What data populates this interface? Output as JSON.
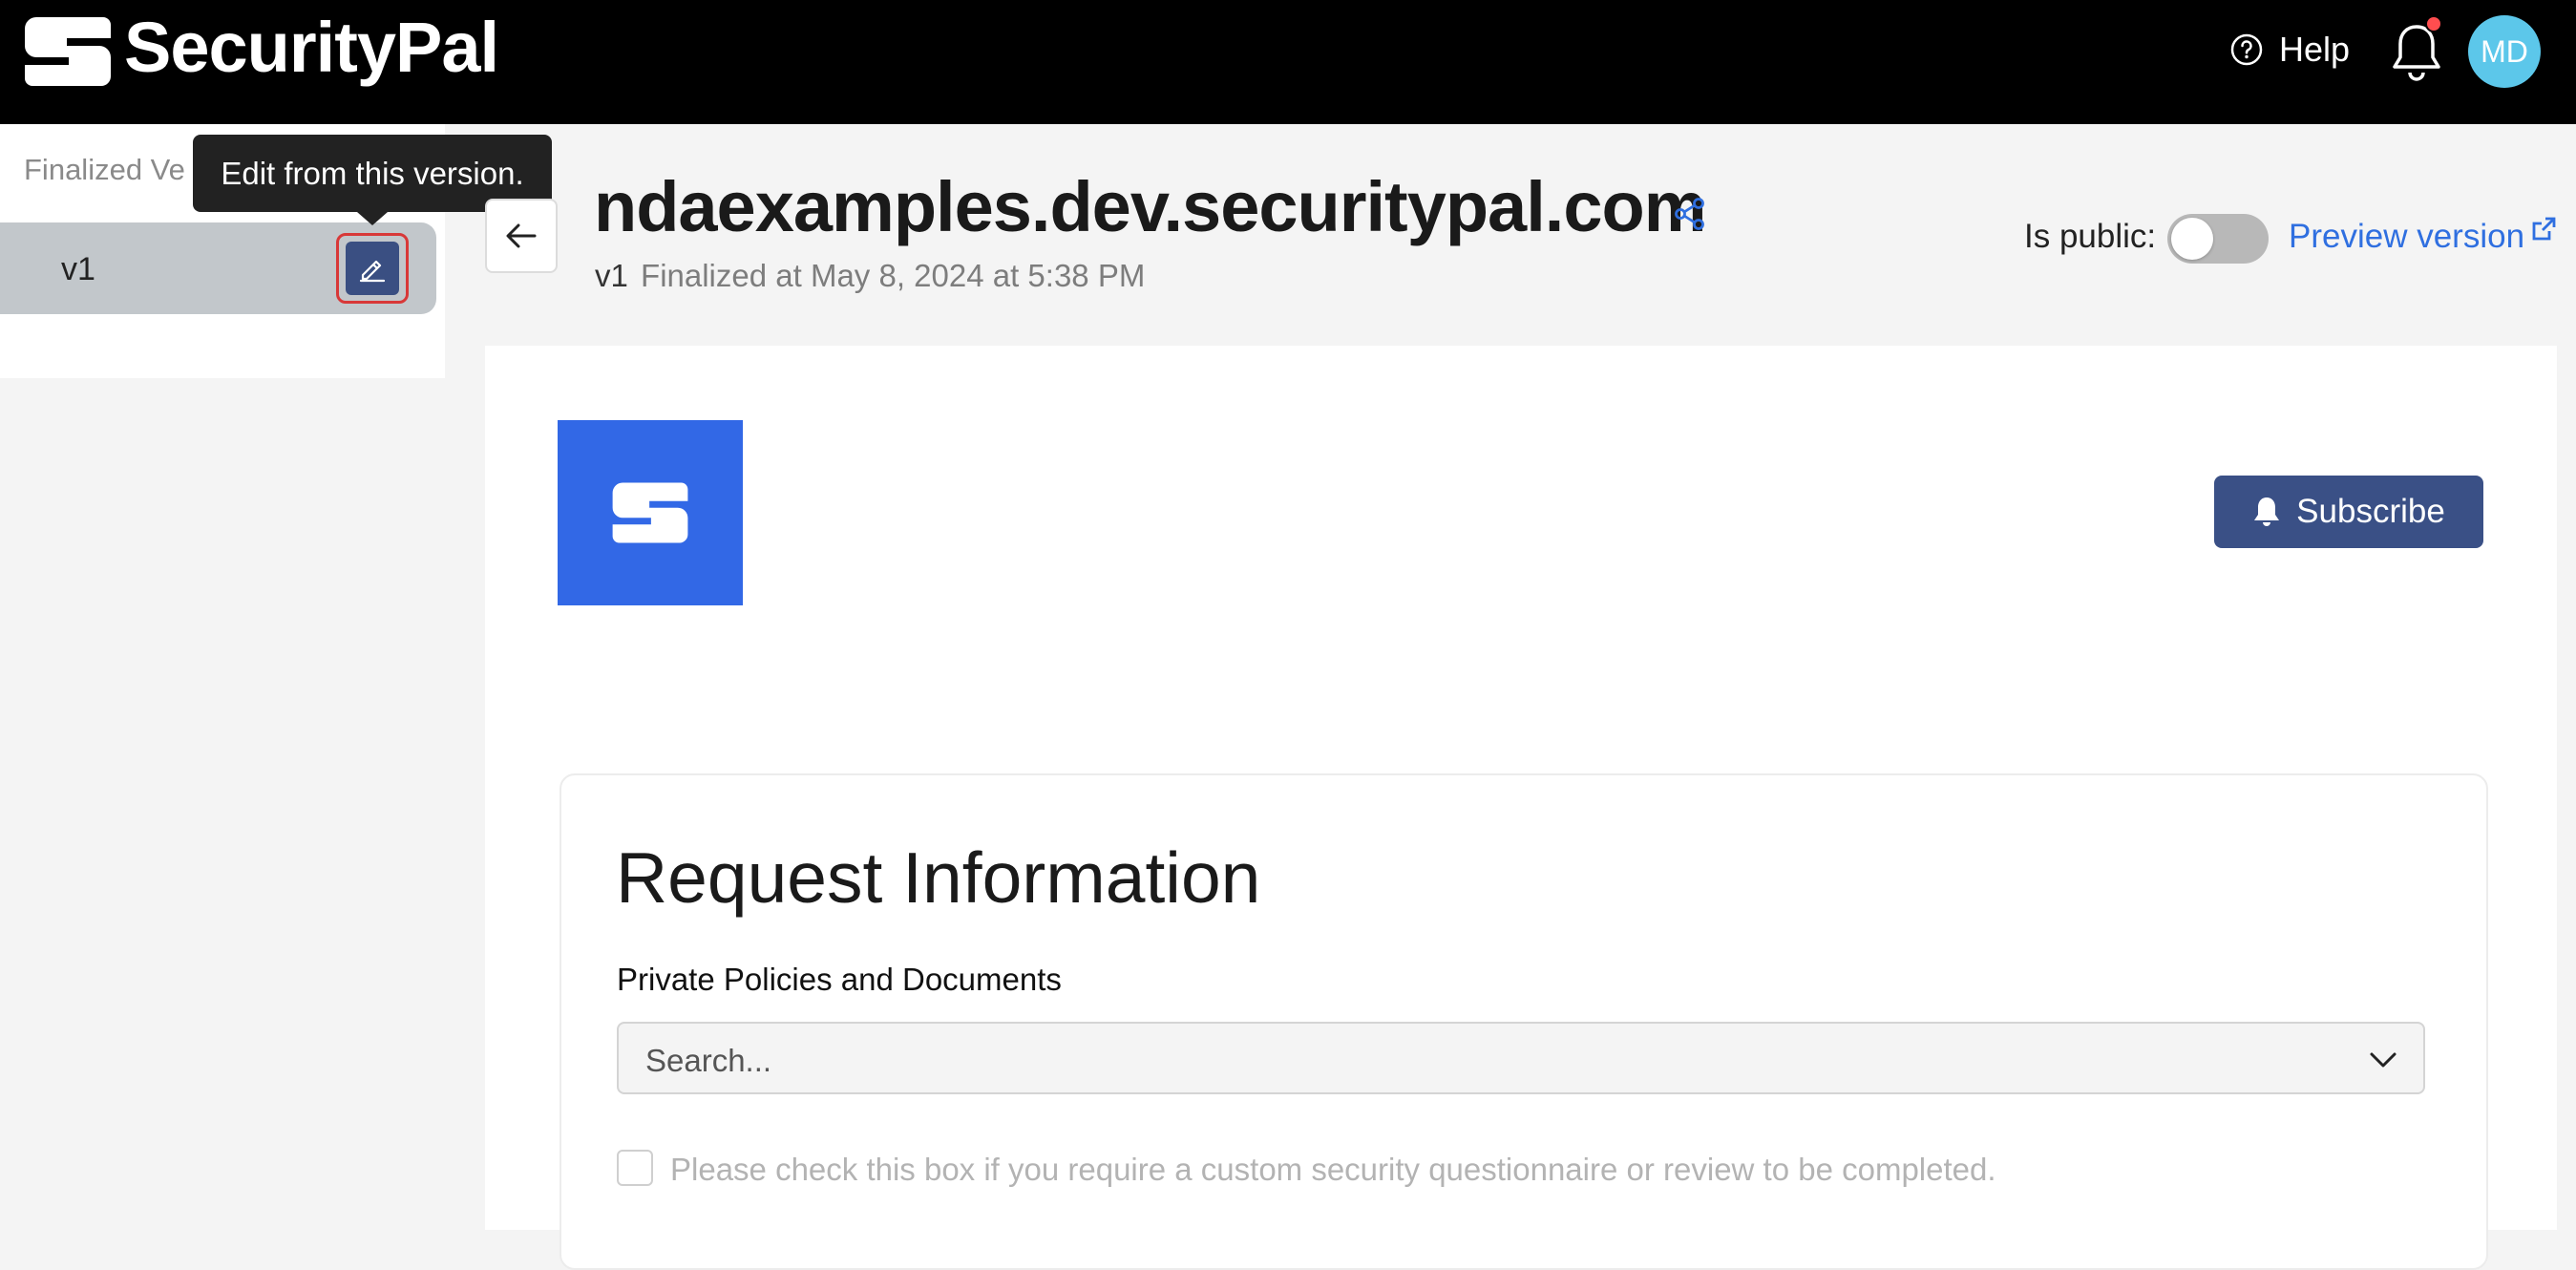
{
  "header": {
    "brand_name": "SecurityPal",
    "help_label": "Help",
    "avatar_initials": "MD",
    "has_notification": true
  },
  "sidebar": {
    "title": "Finalized Ve",
    "versions": [
      {
        "label": "v1",
        "selected": true
      }
    ],
    "tooltip": "Edit from this version."
  },
  "page": {
    "title": "ndaexamples.dev.securitypal.com",
    "version": "v1",
    "finalized_text": "Finalized at May 8, 2024 at 5:38 PM",
    "public_label": "Is public:",
    "is_public": false,
    "preview_label": "Preview version"
  },
  "content": {
    "subscribe_label": "Subscribe",
    "card_title": "Request Information",
    "field_label": "Private Policies and Documents",
    "search_placeholder": "Search...",
    "checkbox_label": "Please check this box if you require a custom security questionnaire or review to be completed.",
    "checkbox_checked": false
  },
  "colors": {
    "topbar": "#000000",
    "accent_link": "#2f6fe0",
    "primary_button": "#3a5086",
    "logo_bg": "#3268e6",
    "avatar_bg": "#5cc7ea",
    "edit_highlight": "#d83838"
  },
  "icons": {
    "brand": "securitypal-logo-icon",
    "help": "question-circle-icon",
    "notifications": "bell-icon",
    "edit": "pencil-icon",
    "back": "arrow-left-icon",
    "share": "share-icon",
    "external": "external-link-icon",
    "subscribe": "bell-icon",
    "dropdown": "chevron-down-icon"
  }
}
